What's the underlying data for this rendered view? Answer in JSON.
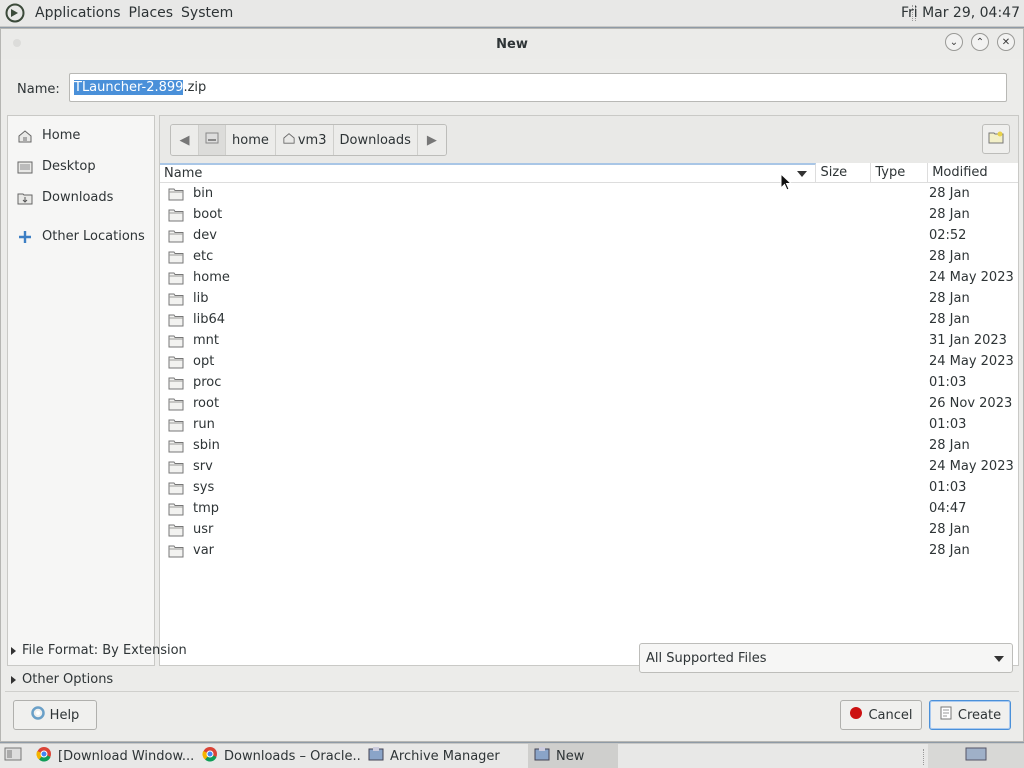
{
  "panel": {
    "menus": [
      "Applications",
      "Places",
      "System"
    ],
    "clock": "Fri Mar 29, 04:47"
  },
  "dialog": {
    "title": "New",
    "name_label": "Name:",
    "name_selected": "TLauncher-2.899",
    "name_rest": ".zip",
    "sidebar": [
      {
        "label": "Home",
        "icon": "home-icon"
      },
      {
        "label": "Desktop",
        "icon": "desktop-icon"
      },
      {
        "label": "Downloads",
        "icon": "downloads-icon"
      },
      {
        "label": "Other Locations",
        "icon": "plus-icon"
      }
    ],
    "path": [
      "home",
      "vm3",
      "Downloads"
    ],
    "columns": {
      "name": "Name",
      "size": "Size",
      "type": "Type",
      "modified": "Modified"
    },
    "files": [
      {
        "name": "bin",
        "modified": "28 Jan"
      },
      {
        "name": "boot",
        "modified": "28 Jan"
      },
      {
        "name": "dev",
        "modified": "02:52"
      },
      {
        "name": "etc",
        "modified": "28 Jan"
      },
      {
        "name": "home",
        "modified": "24 May 2023"
      },
      {
        "name": "lib",
        "modified": "28 Jan"
      },
      {
        "name": "lib64",
        "modified": "28 Jan"
      },
      {
        "name": "mnt",
        "modified": "31 Jan 2023"
      },
      {
        "name": "opt",
        "modified": "24 May 2023"
      },
      {
        "name": "proc",
        "modified": "01:03"
      },
      {
        "name": "root",
        "modified": "26 Nov 2023"
      },
      {
        "name": "run",
        "modified": "01:03"
      },
      {
        "name": "sbin",
        "modified": "28 Jan"
      },
      {
        "name": "srv",
        "modified": "24 May 2023"
      },
      {
        "name": "sys",
        "modified": "01:03"
      },
      {
        "name": "tmp",
        "modified": "04:47"
      },
      {
        "name": "usr",
        "modified": "28 Jan"
      },
      {
        "name": "var",
        "modified": "28 Jan"
      }
    ],
    "file_format": "File Format: By Extension",
    "other_options": "Other Options",
    "filter": "All Supported Files",
    "help": "Help",
    "cancel": "Cancel",
    "create": "Create"
  },
  "taskbar": [
    {
      "label": "[Download Window...",
      "icon": "chrome-icon"
    },
    {
      "label": "Downloads – Oracle...",
      "icon": "chrome-icon"
    },
    {
      "label": "Archive Manager",
      "icon": "archive-icon"
    },
    {
      "label": "New",
      "icon": "archive-icon",
      "active": true
    }
  ],
  "colors": {
    "selection": "#4a90d9",
    "accent_blue": "#4a90d9"
  }
}
